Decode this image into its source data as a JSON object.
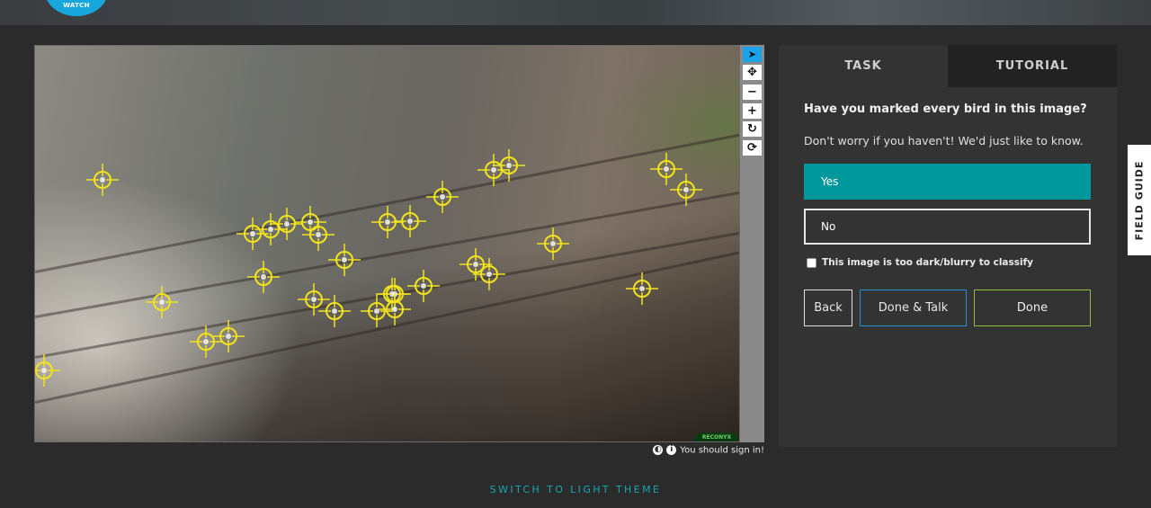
{
  "header": {
    "logo_text": "WATCH"
  },
  "subject": {
    "image_description_icon": "cliff-photo",
    "watermark_text": "RECONYX",
    "marker_color": "#f2e41c"
  },
  "toolbar": {
    "tools": [
      {
        "name": "annotate-pointer-icon",
        "glyph": "➤"
      },
      {
        "name": "pan-move-icon",
        "glyph": "✥"
      },
      {
        "name": "zoom-out-icon",
        "glyph": "−"
      },
      {
        "name": "zoom-in-icon",
        "glyph": "+"
      },
      {
        "name": "rotate-icon",
        "glyph": "↻"
      },
      {
        "name": "reset-icon",
        "glyph": "⟳"
      }
    ]
  },
  "meta": {
    "invert_icon": "◐",
    "info_icon": "i",
    "sign_in_text": "You should sign in!"
  },
  "theme_switch": "SWITCH TO LIGHT THEME",
  "task_panel": {
    "tabs": {
      "task": "TASK",
      "tutorial": "TUTORIAL"
    },
    "question": "Have you marked every bird in this image?",
    "help": "Don't worry if you haven't! We'd just like to know.",
    "answers": {
      "yes": "Yes",
      "no": "No"
    },
    "dark_checkbox": "This image is too dark/blurry to classify",
    "buttons": {
      "back": "Back",
      "done_talk": "Done & Talk",
      "done": "Done"
    }
  },
  "field_guide": "FIELD GUIDE",
  "colors": {
    "accent": "#00979d",
    "link": "#17a8b3",
    "talk_border": "#1f8fd6",
    "done_border": "#8fba3a"
  }
}
